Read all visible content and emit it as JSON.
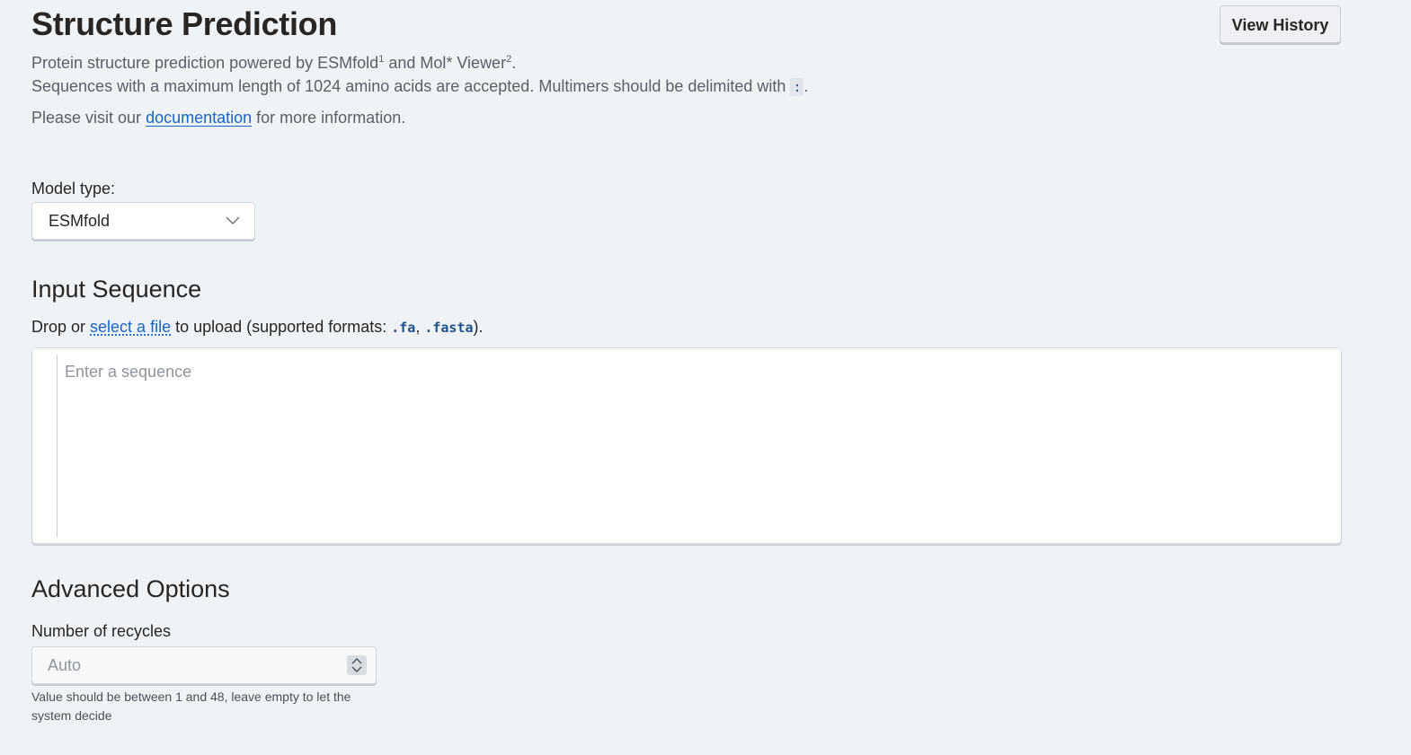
{
  "header": {
    "title": "Structure Prediction",
    "history_button": "View History"
  },
  "description": {
    "line1_part1": "Protein structure prediction powered by ESMfold",
    "line1_sup1": "1",
    "line1_part2": " and Mol* Viewer",
    "line1_sup2": "2",
    "line1_end": ".",
    "line2_text": "Sequences with a maximum length of 1024 amino acids are accepted. Multimers should be delimited with ",
    "line2_code": ":",
    "line2_end": ".",
    "line3_before": "Please visit our ",
    "line3_link": "documentation",
    "line3_after": " for more information."
  },
  "model": {
    "label": "Model type:",
    "selected": "ESMfold",
    "icon": "chevron-down-icon"
  },
  "input_sequence": {
    "heading": "Input Sequence",
    "hint_before": "Drop or ",
    "hint_link": "select a file",
    "hint_middle": " to upload (supported formats: ",
    "format1": ".fa",
    "separator": ", ",
    "format2": ".fasta",
    "hint_end": ").",
    "placeholder": "Enter a sequence"
  },
  "advanced": {
    "heading": "Advanced Options",
    "recycles_label": "Number of recycles",
    "recycles_placeholder": "Auto",
    "recycles_help": "Value should be between 1 and 48, leave empty to let the system decide"
  }
}
